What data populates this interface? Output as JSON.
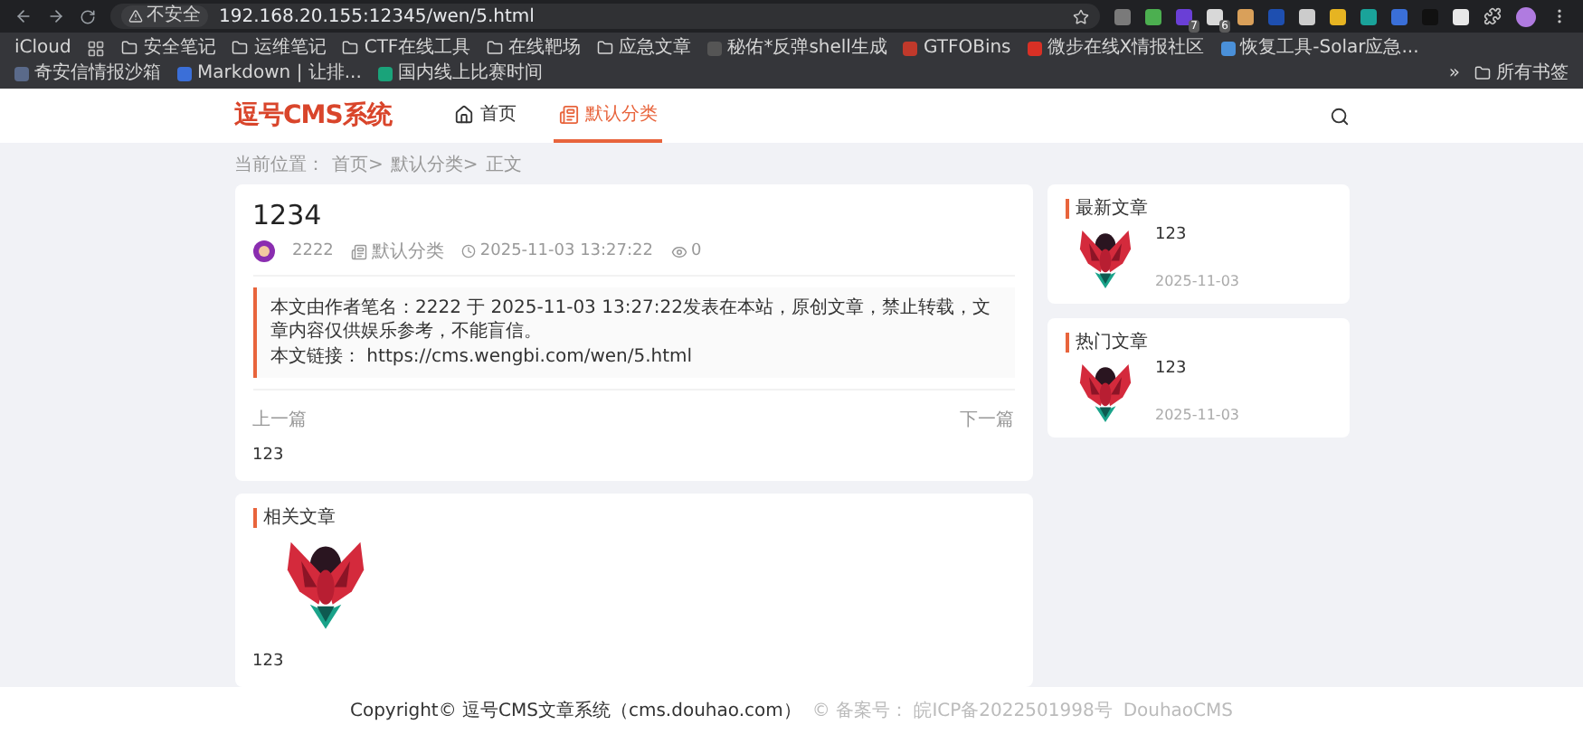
{
  "browser": {
    "security": "不安全",
    "url": "192.168.20.155:12345/wen/5.html",
    "extensions": [
      {
        "color": "#7a7a7a"
      },
      {
        "color": "#4caf50"
      },
      {
        "color": "#6a3fd6",
        "badge": "7"
      },
      {
        "color": "#d8d8d8",
        "badge": "6"
      },
      {
        "color": "#d9a05a"
      },
      {
        "color": "#1e4fb0"
      },
      {
        "color": "#cccccc"
      },
      {
        "color": "#e6b422"
      },
      {
        "color": "#1aa39a"
      },
      {
        "color": "#3a6fd8"
      },
      {
        "color": "#111111"
      },
      {
        "color": "#e8e8e8"
      }
    ],
    "bookmarks": [
      {
        "kind": "text",
        "label": "iCloud"
      },
      {
        "kind": "apps"
      },
      {
        "kind": "folder",
        "label": "安全笔记"
      },
      {
        "kind": "folder",
        "label": "运维笔记"
      },
      {
        "kind": "folder",
        "label": "CTF在线工具"
      },
      {
        "kind": "folder",
        "label": "在线靶场"
      },
      {
        "kind": "folder",
        "label": "应急文章"
      },
      {
        "kind": "site",
        "label": "秘佑*反弹shell生成",
        "color": "#555555"
      },
      {
        "kind": "site",
        "label": "GTFOBins",
        "color": "#c0392b"
      },
      {
        "kind": "site",
        "label": "微步在线X情报社区",
        "color": "#d93025"
      },
      {
        "kind": "site",
        "label": "恢复工具-Solar应急...",
        "color": "#4a90d9"
      },
      {
        "kind": "site",
        "label": "奇安信情报沙箱",
        "color": "#5a6a8a"
      },
      {
        "kind": "site",
        "label": "Markdown | 让排...",
        "color": "#3b6fd8"
      },
      {
        "kind": "site",
        "label": "国内线上比赛时间",
        "color": "#1aa37a"
      }
    ],
    "more": "»",
    "all_bookmarks": "所有书签"
  },
  "site": {
    "logo": "逗号CMS系统",
    "nav": [
      {
        "label": "首页",
        "selected": false
      },
      {
        "label": "默认分类",
        "selected": true
      }
    ]
  },
  "breadcrumb": {
    "prefix": "当前位置：",
    "items": [
      "首页>",
      "默认分类>",
      "正文"
    ]
  },
  "article": {
    "title": "1234",
    "author": "2222",
    "category": "默认分类",
    "date": "2025-11-03 13:27:22",
    "views": "0",
    "notice": [
      "本文由作者笔名：2222 于 2025-11-03 13:27:22发表在本站，原创文章，禁止转载，文章内容仅供娱乐参考，不能盲信。",
      "本文链接： https://cms.wengbi.com/wen/5.html"
    ],
    "prev_label": "上一篇",
    "prev_title": "123",
    "next_label": "下一篇"
  },
  "related": {
    "title": "相关文章",
    "items": [
      {
        "title": "123"
      }
    ]
  },
  "sidebar": [
    {
      "title": "最新文章",
      "items": [
        {
          "title": "123",
          "date": "2025-11-03"
        }
      ]
    },
    {
      "title": "热门文章",
      "items": [
        {
          "title": "123",
          "date": "2025-11-03"
        }
      ]
    }
  ],
  "footer": {
    "copyright": "Copyright© 逗号CMS文章系统（cms.douhao.com）",
    "icp": "© 备案号： 皖ICP备2022501998号",
    "brand": "DouhaoCMS"
  }
}
